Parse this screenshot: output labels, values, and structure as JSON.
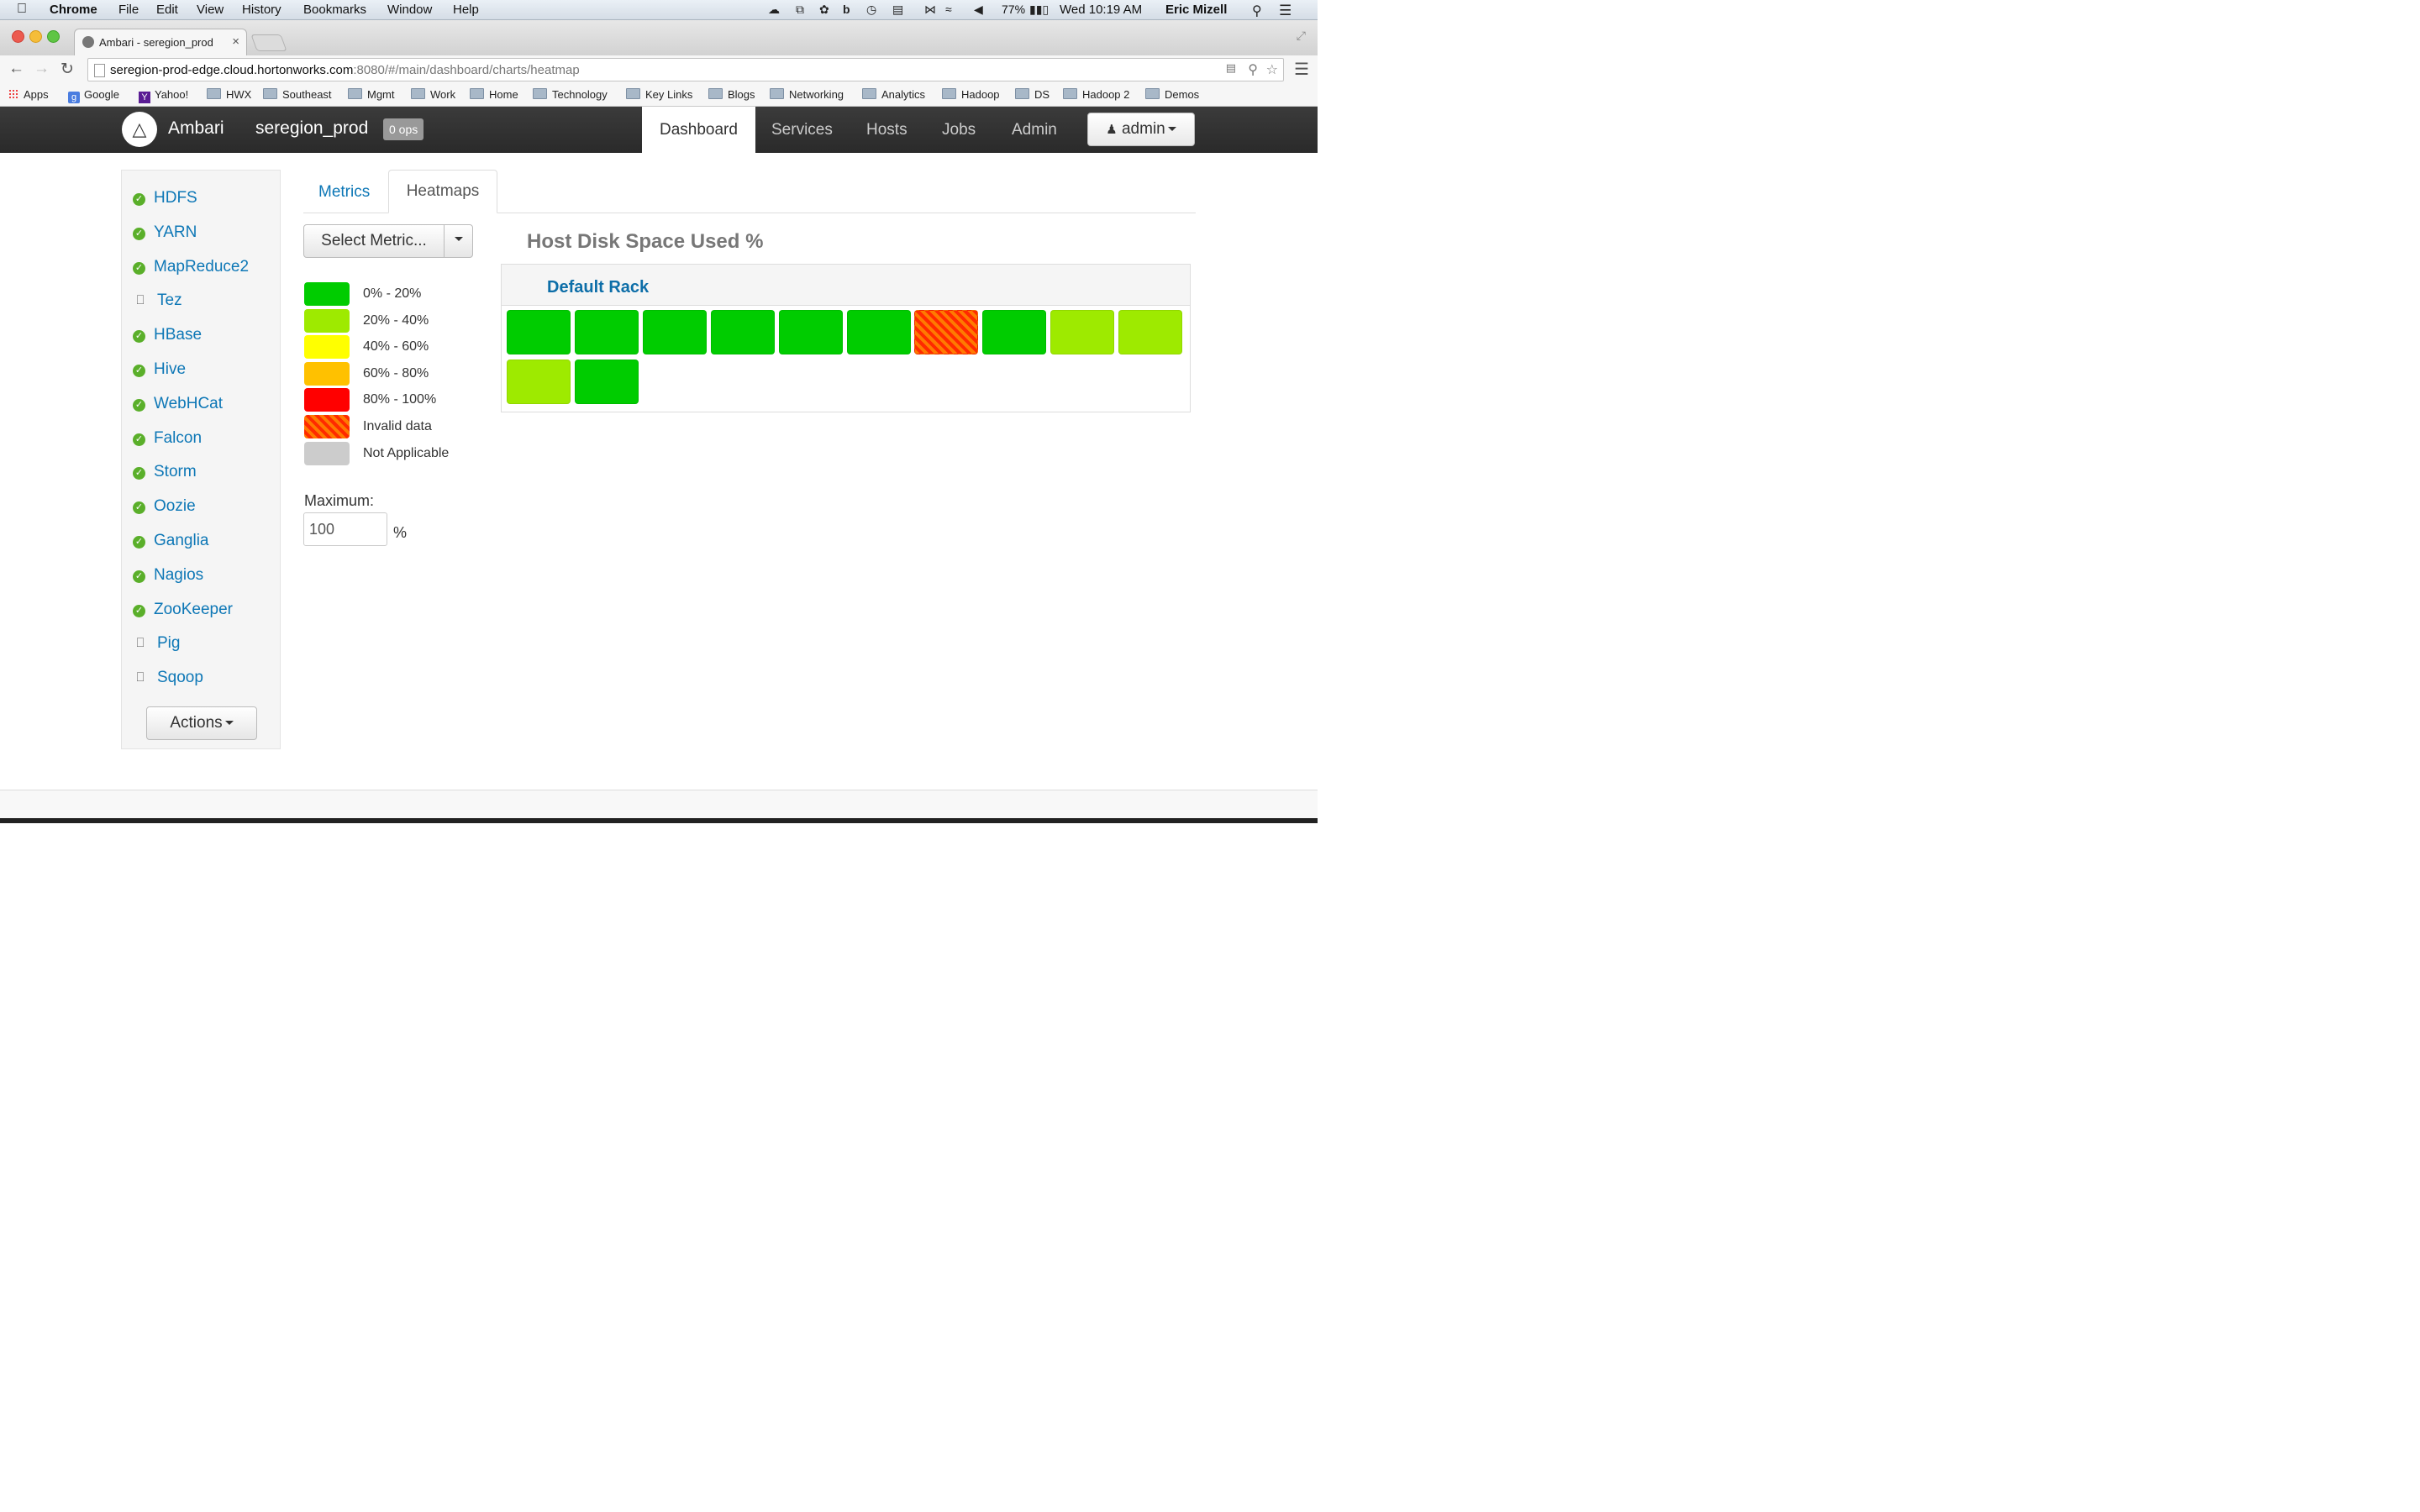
{
  "menubar": {
    "app": "Chrome",
    "items": [
      "File",
      "Edit",
      "View",
      "History",
      "Bookmarks",
      "Window",
      "Help"
    ],
    "battery": "77%",
    "clock": "Wed 10:19 AM",
    "user": "Eric Mizell"
  },
  "browser": {
    "tab_title": "Ambari - seregion_prod",
    "url_host": "seregion-prod-edge.cloud.hortonworks.com",
    "url_rest": ":8080/#/main/dashboard/charts/heatmap",
    "bookmarks": [
      "Apps",
      "Google",
      "Yahoo!",
      "HWX",
      "Southeast",
      "Mgmt",
      "Work",
      "Home",
      "Technology",
      "Key Links",
      "Blogs",
      "Networking",
      "Analytics",
      "Hadoop",
      "DS",
      "Hadoop 2",
      "Demos"
    ]
  },
  "navbar": {
    "brand": "Ambari",
    "cluster": "seregion_prod",
    "ops": "0 ops",
    "links": [
      "Dashboard",
      "Services",
      "Hosts",
      "Jobs",
      "Admin"
    ],
    "active": "Dashboard",
    "user_menu": "admin"
  },
  "sidebar": {
    "services": [
      {
        "name": "HDFS",
        "status": "ok"
      },
      {
        "name": "YARN",
        "status": "ok"
      },
      {
        "name": "MapReduce2",
        "status": "ok"
      },
      {
        "name": "Tez",
        "status": "client"
      },
      {
        "name": "HBase",
        "status": "ok"
      },
      {
        "name": "Hive",
        "status": "ok"
      },
      {
        "name": "WebHCat",
        "status": "ok"
      },
      {
        "name": "Falcon",
        "status": "ok"
      },
      {
        "name": "Storm",
        "status": "ok"
      },
      {
        "name": "Oozie",
        "status": "ok"
      },
      {
        "name": "Ganglia",
        "status": "ok"
      },
      {
        "name": "Nagios",
        "status": "ok"
      },
      {
        "name": "ZooKeeper",
        "status": "ok"
      },
      {
        "name": "Pig",
        "status": "client"
      },
      {
        "name": "Sqoop",
        "status": "client"
      }
    ],
    "actions": "Actions"
  },
  "main": {
    "tabs": [
      "Metrics",
      "Heatmaps"
    ],
    "active_tab": "Heatmaps",
    "select_metric": "Select Metric...",
    "legend": [
      {
        "label": "0% - 20%",
        "color": "#00cc00"
      },
      {
        "label": "20% - 40%",
        "color": "#9eea00"
      },
      {
        "label": "40% - 60%",
        "color": "#ffff00"
      },
      {
        "label": "60% - 80%",
        "color": "#ffc100"
      },
      {
        "label": "80% - 100%",
        "color": "#ff0000"
      },
      {
        "label": "Invalid data",
        "color": "striped"
      },
      {
        "label": "Not Applicable",
        "color": "#cccccc"
      }
    ],
    "maximum_label": "Maximum:",
    "maximum_value": "100",
    "maximum_unit": "%"
  },
  "chart_data": {
    "type": "heatmap",
    "title": "Host Disk Space Used %",
    "rack": "Default Rack",
    "hosts_color_band": [
      "0-20",
      "0-20",
      "0-20",
      "0-20",
      "0-20",
      "0-20",
      "invalid",
      "0-20",
      "20-40",
      "20-40",
      "20-40",
      "0-20"
    ],
    "band_colors": {
      "0-20": "#00cc00",
      "20-40": "#9eea00",
      "invalid": "striped"
    }
  }
}
